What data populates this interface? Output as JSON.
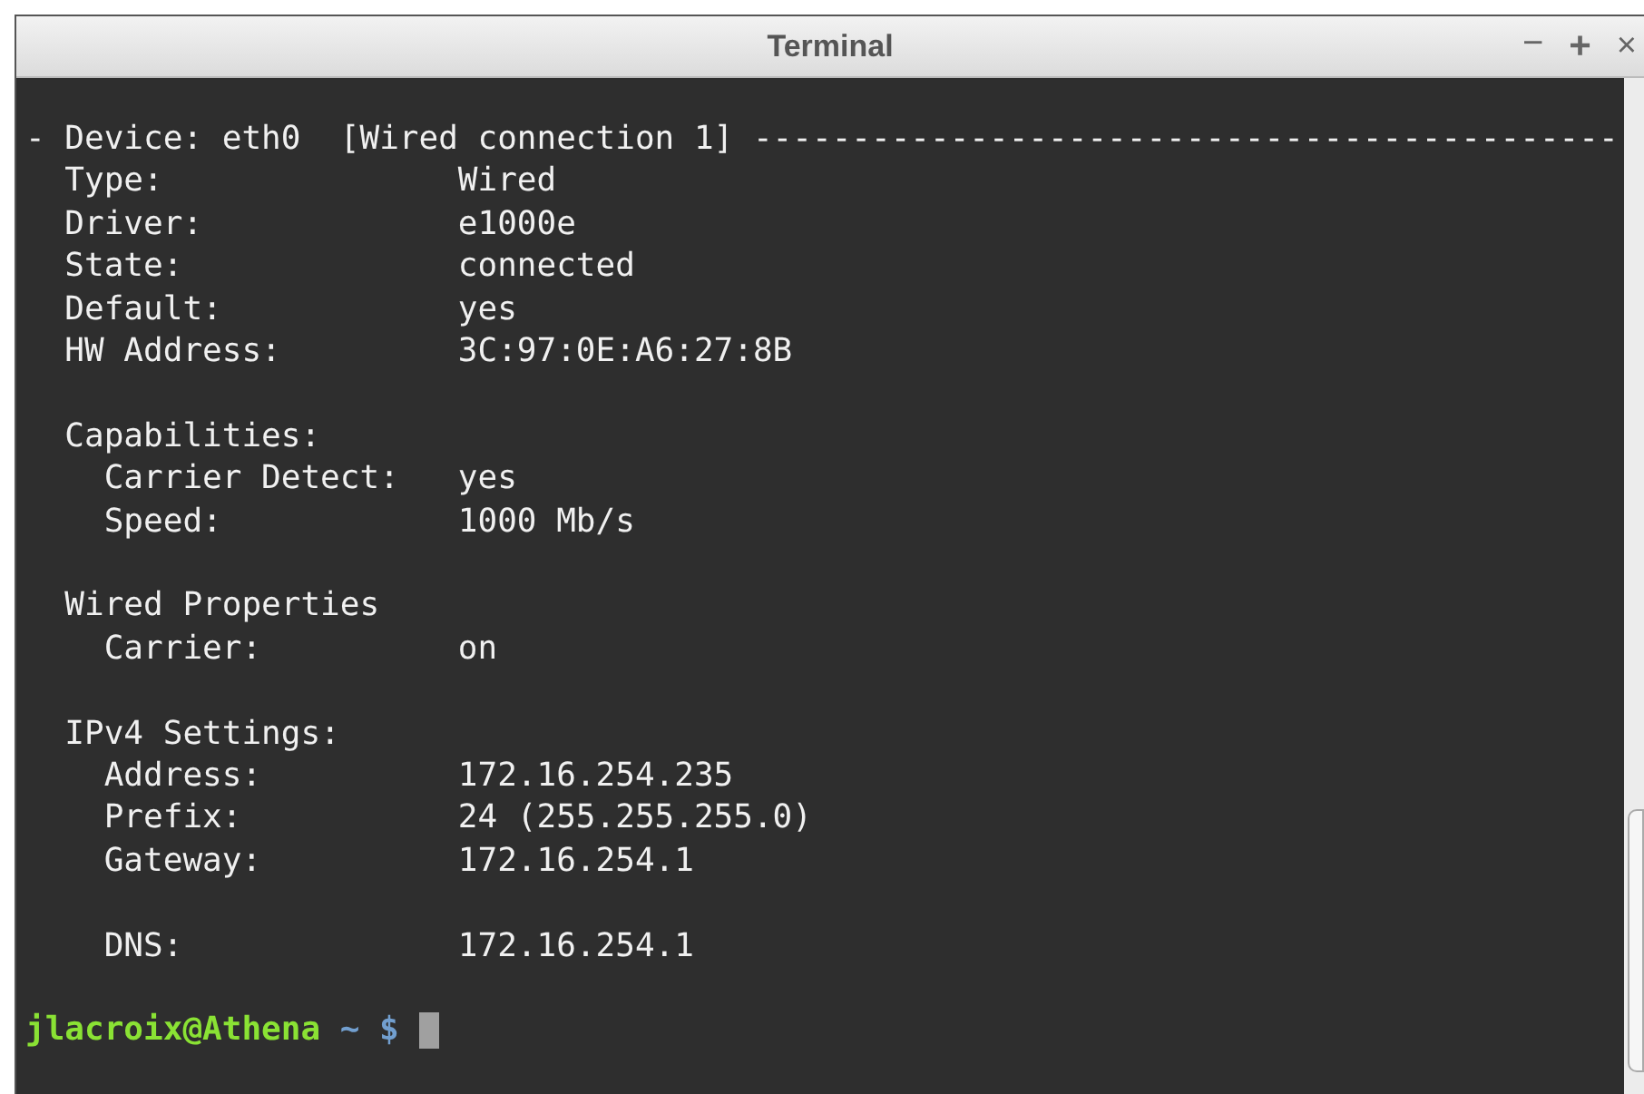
{
  "window": {
    "title": "Terminal",
    "controls": [
      {
        "kind": "minimize",
        "label": "−"
      },
      {
        "kind": "maximize",
        "label": "+"
      },
      {
        "kind": "close",
        "label": "×"
      }
    ]
  },
  "output_sections": [
    {
      "lines": [
        "- Device: eth0  [Wired connection 1] --------------------------------------------",
        "  Type:               Wired",
        "  Driver:             e1000e",
        "  State:              connected",
        "  Default:            yes",
        "  HW Address:         3C:97:0E:A6:27:8B"
      ]
    },
    {
      "lines": [
        "  Capabilities:",
        "    Carrier Detect:   yes",
        "    Speed:            1000 Mb/s"
      ]
    },
    {
      "lines": [
        "  Wired Properties",
        "    Carrier:          on"
      ]
    },
    {
      "lines": [
        "  IPv4 Settings:",
        "    Address:          172.16.254.235",
        "    Prefix:           24 (255.255.255.0)",
        "    Gateway:          172.16.254.1"
      ]
    },
    {
      "lines": [
        "    DNS:              172.16.254.1"
      ]
    }
  ],
  "prompt": {
    "user_host": "jlacroix@Athena",
    "path_symbol": "~ $"
  }
}
